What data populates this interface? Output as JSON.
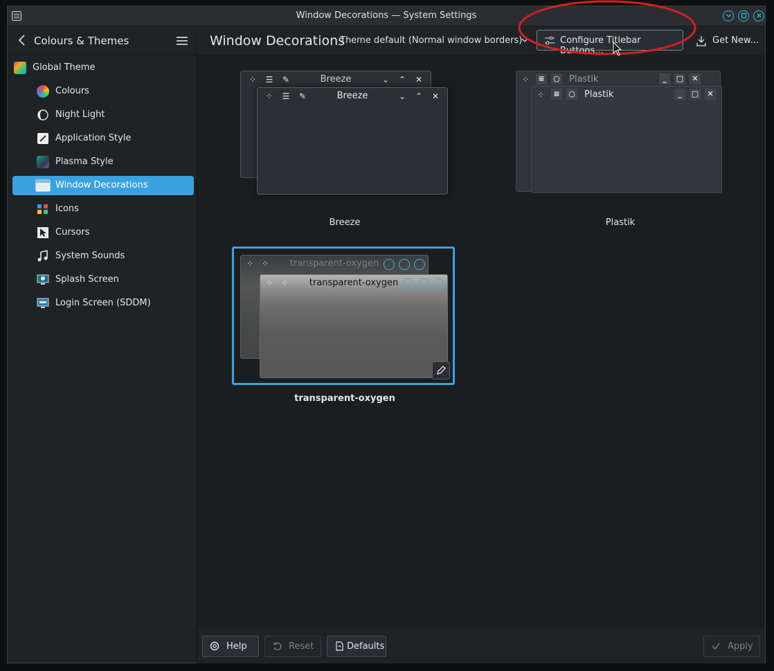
{
  "window": {
    "title": "Window Decorations — System Settings"
  },
  "sidebar": {
    "back_label": "Colours & Themes",
    "items": [
      {
        "label": "Global Theme",
        "icon": "global-theme-icon"
      },
      {
        "label": "Colours",
        "icon": "colours-icon"
      },
      {
        "label": "Night Light",
        "icon": "night-light-icon"
      },
      {
        "label": "Application Style",
        "icon": "application-style-icon"
      },
      {
        "label": "Plasma Style",
        "icon": "plasma-style-icon"
      },
      {
        "label": "Window Decorations",
        "icon": "window-decorations-icon",
        "selected": true
      },
      {
        "label": "Icons",
        "icon": "icons-icon"
      },
      {
        "label": "Cursors",
        "icon": "cursors-icon"
      },
      {
        "label": "System Sounds",
        "icon": "system-sounds-icon"
      },
      {
        "label": "Splash Screen",
        "icon": "splash-screen-icon"
      },
      {
        "label": "Login Screen (SDDM)",
        "icon": "login-screen-icon"
      }
    ]
  },
  "header": {
    "title": "Window Decorations",
    "theme_combo": "Theme default (Normal window borders)",
    "configure_button": "Configure Titlebar Buttons...",
    "get_new": "Get New..."
  },
  "decorations": [
    {
      "name": "Breeze",
      "title": "Breeze"
    },
    {
      "name": "Plastik",
      "title": "Plastik"
    },
    {
      "name": "transparent-oxygen",
      "title": "transparent-oxygen",
      "back_title": "transparent-oxygen",
      "selected": true
    }
  ],
  "footer": {
    "help": "Help",
    "reset": "Reset",
    "defaults": "Defaults",
    "apply": "Apply"
  },
  "colors": {
    "accent": "#3aa2de",
    "highlight": "#d42020"
  }
}
